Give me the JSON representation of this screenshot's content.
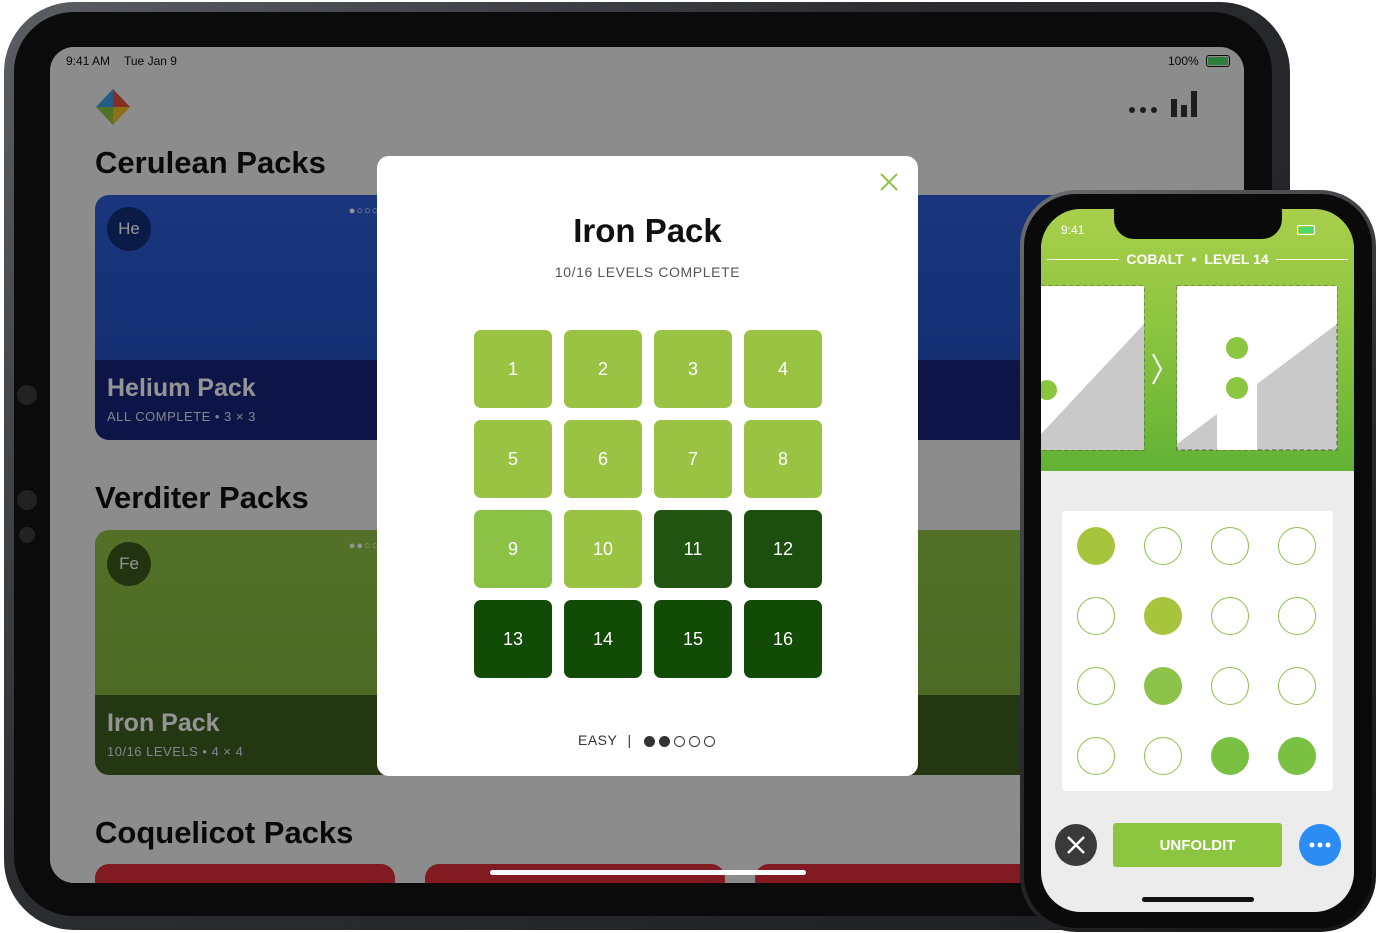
{
  "ipad": {
    "status": {
      "time": "9:41 AM",
      "date": "Tue Jan 9",
      "battery": "100%"
    },
    "icons": {
      "logo": "diamond-logo-icon",
      "more": "more-dots-icon",
      "stats": "bar-chart-icon"
    },
    "sections": [
      {
        "title": "Cerulean Packs"
      },
      {
        "title": "Verditer Packs"
      },
      {
        "title": "Coquelicot Packs"
      }
    ],
    "cards": {
      "helium": {
        "badge": "He",
        "title": "Helium Pack",
        "subtitle": "ALL COMPLETE  •  3 × 3"
      },
      "iron": {
        "badge": "Fe",
        "title": "Iron Pack",
        "subtitle": "10/16 LEVELS  •  4 × 4"
      }
    }
  },
  "modal": {
    "title": "Iron Pack",
    "subtitle": "10/16 LEVELS COMPLETE",
    "levels": [
      {
        "label": "1",
        "color": "#9ac243"
      },
      {
        "label": "2",
        "color": "#9ac243"
      },
      {
        "label": "3",
        "color": "#9ac243"
      },
      {
        "label": "4",
        "color": "#9ac243"
      },
      {
        "label": "5",
        "color": "#9ac243"
      },
      {
        "label": "6",
        "color": "#9ac243"
      },
      {
        "label": "7",
        "color": "#9ac243"
      },
      {
        "label": "8",
        "color": "#9ac243"
      },
      {
        "label": "9",
        "color": "#8bc246"
      },
      {
        "label": "10",
        "color": "#9ac243"
      },
      {
        "label": "11",
        "color": "#235512"
      },
      {
        "label": "12",
        "color": "#1c4f0d"
      },
      {
        "label": "13",
        "color": "#124b06"
      },
      {
        "label": "14",
        "color": "#124b06"
      },
      {
        "label": "15",
        "color": "#124b06"
      },
      {
        "label": "16",
        "color": "#124b06"
      }
    ],
    "difficulty": {
      "label": "EASY",
      "separator": "|",
      "filled": 2,
      "total": 5
    }
  },
  "iphone": {
    "status": {
      "time": "9:41"
    },
    "header": {
      "pack": "COBALT",
      "separator": "•",
      "level": "LEVEL 14"
    },
    "dots": [
      [
        "filled-a",
        "empty",
        "empty",
        "empty"
      ],
      [
        "empty",
        "filled-a",
        "empty",
        "empty"
      ],
      [
        "empty",
        "filled-b",
        "empty",
        "empty"
      ],
      [
        "empty",
        "empty",
        "filled-c",
        "filled-c"
      ]
    ],
    "dot_colors": {
      "filled-a": "#a6c43c",
      "filled-b": "#8bc24a",
      "filled-c": "#7ac142",
      "empty_border": "#8bc24a"
    },
    "action_label": "UNFOLDIT"
  }
}
